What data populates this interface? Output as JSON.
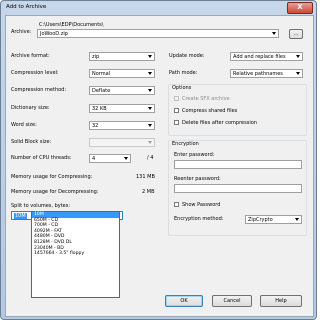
{
  "window": {
    "title": "Add to Archive",
    "close_glyph": "X"
  },
  "archive": {
    "label": "Archive:",
    "path": "C:\\Users\\EDP\\Documents\\",
    "name": "JoWooD.zip",
    "browse_label": "..."
  },
  "left": {
    "format_label": "Archive format:",
    "format_value": "zip",
    "level_label": "Compression level:",
    "level_value": "Normal",
    "method_label": "Compression method:",
    "method_value": "Deflate",
    "dict_label": "Dictionary size:",
    "dict_value": "32 KB",
    "word_label": "Word size:",
    "word_value": "32",
    "solid_label": "Solid Block size:",
    "solid_value": "",
    "threads_label": "Number of CPU threads:",
    "threads_value": "4",
    "threads_max": "/ 4",
    "mem_compress_label": "Memory usage for Compressing:",
    "mem_compress_value": "131 MB",
    "mem_decompress_label": "Memory usage for Decompressing:",
    "mem_decompress_value": "2 MB",
    "split_label": "Split to volumes, bytes:",
    "split_value": "10M",
    "split_options": [
      "10M",
      "650M - CD",
      "700M - CD",
      "4092M - FAT",
      "4480M - DVD",
      "8128M - DVD DL",
      "23040M - BD",
      "1457664 - 3.5\" floppy"
    ],
    "split_selected_index": 0
  },
  "right": {
    "update_label": "Update mode:",
    "update_value": "Add and replace files",
    "path_label": "Path mode:",
    "path_value": "Relative pathnames",
    "options_title": "Options",
    "sfx_label": "Create SFX archive",
    "shared_label": "Compress shared files",
    "delete_label": "Delete files after compression",
    "encryption_title": "Encryption",
    "enter_pw_label": "Enter password:",
    "reenter_pw_label": "Reenter password:",
    "show_pw_label": "Show Password",
    "enc_method_label": "Encryption method:",
    "enc_method_value": "ZipCrypto"
  },
  "buttons": {
    "ok": "OK",
    "cancel": "Cancel",
    "help": "Help"
  }
}
